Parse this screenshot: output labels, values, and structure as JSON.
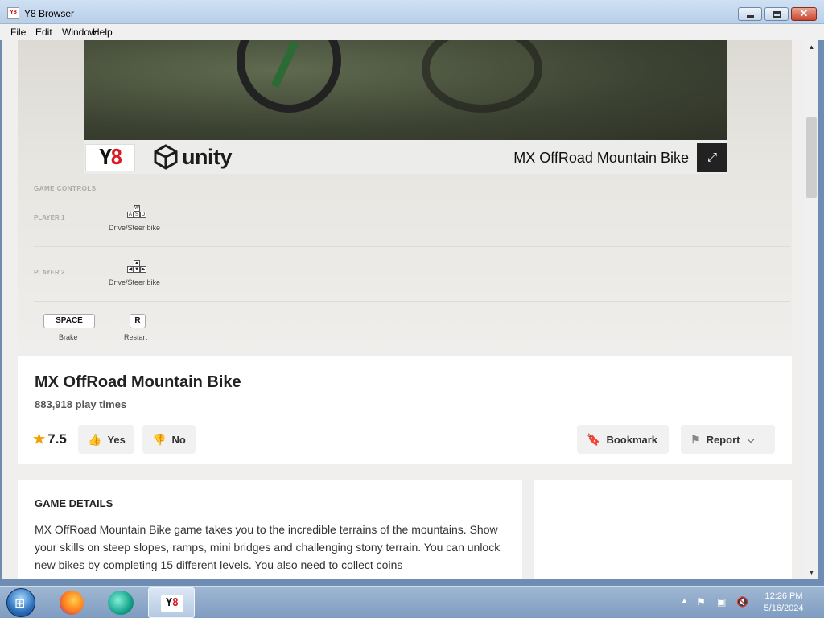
{
  "window": {
    "title": "Y8 Browser",
    "icon_label": "Y8",
    "controls": {
      "minimize": "minimize-icon",
      "maximize": "maximize-icon",
      "close": "close-icon",
      "close_glyph": "✕"
    }
  },
  "menu": [
    "File",
    "Edit",
    "Window",
    "Help"
  ],
  "game": {
    "title_overlay": "MX OffRoad Mountain Bike",
    "logo_y": "Y",
    "logo_8": "8",
    "engine_label": "unity",
    "fullscreen_glyph": "⤢"
  },
  "controls": {
    "heading": "GAME CONTROLS",
    "player1": {
      "label": "PLAYER 1",
      "keys": [
        "W",
        "A",
        "S",
        "D"
      ],
      "caption": "Drive/Steer bike"
    },
    "player2": {
      "label": "PLAYER 2",
      "keys": [
        "▲",
        "◀",
        "▼",
        "▶"
      ],
      "caption": "Drive/Steer bike"
    },
    "extra": [
      {
        "key": "SPACE",
        "caption": "Brake"
      },
      {
        "key": "R",
        "caption": "Restart"
      }
    ]
  },
  "info": {
    "name": "MX OffRoad Mountain Bike",
    "play_times": "883,918 play times",
    "rating": "7.5",
    "yes_label": "Yes",
    "no_label": "No",
    "bookmark_label": "Bookmark",
    "report_label": "Report"
  },
  "details": {
    "heading": "GAME DETAILS",
    "text": "MX OffRoad Mountain Bike game takes you to the incredible terrains of the mountains. Show your skills on steep slopes, ramps, mini bridges and challenging stony terrain. You can unlock new bikes by completing 15 different levels. You also need to collect coins"
  },
  "taskbar": {
    "y8_label_y": "Y",
    "y8_label_8": "8",
    "time": "12:26 PM",
    "date": "5/16/2024"
  }
}
